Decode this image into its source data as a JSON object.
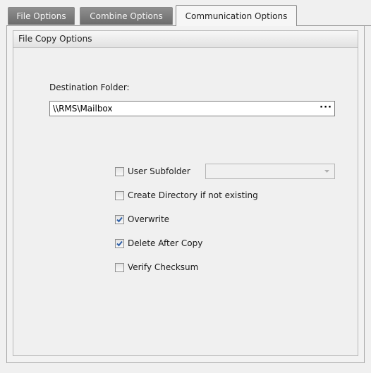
{
  "tabs": [
    {
      "label": "File Options",
      "active": false
    },
    {
      "label": "Combine Options",
      "active": false
    },
    {
      "label": "Communication Options",
      "active": true
    }
  ],
  "group": {
    "title": "File Copy Options"
  },
  "destination": {
    "label": "Destination Folder:",
    "value": "\\\\RMS\\Mailbox",
    "browse_label": "···"
  },
  "user_subfolder": {
    "label": "User Subfolder",
    "checked": false,
    "dropdown_value": ""
  },
  "options": [
    {
      "label": "Create Directory if not existing",
      "checked": false
    },
    {
      "label": "Overwrite",
      "checked": true
    },
    {
      "label": "Delete After Copy",
      "checked": true
    },
    {
      "label": "Verify Checksum",
      "checked": false
    }
  ],
  "colors": {
    "check_blue": "#2d5fa8",
    "tab_inactive": "#7d7d7d"
  }
}
